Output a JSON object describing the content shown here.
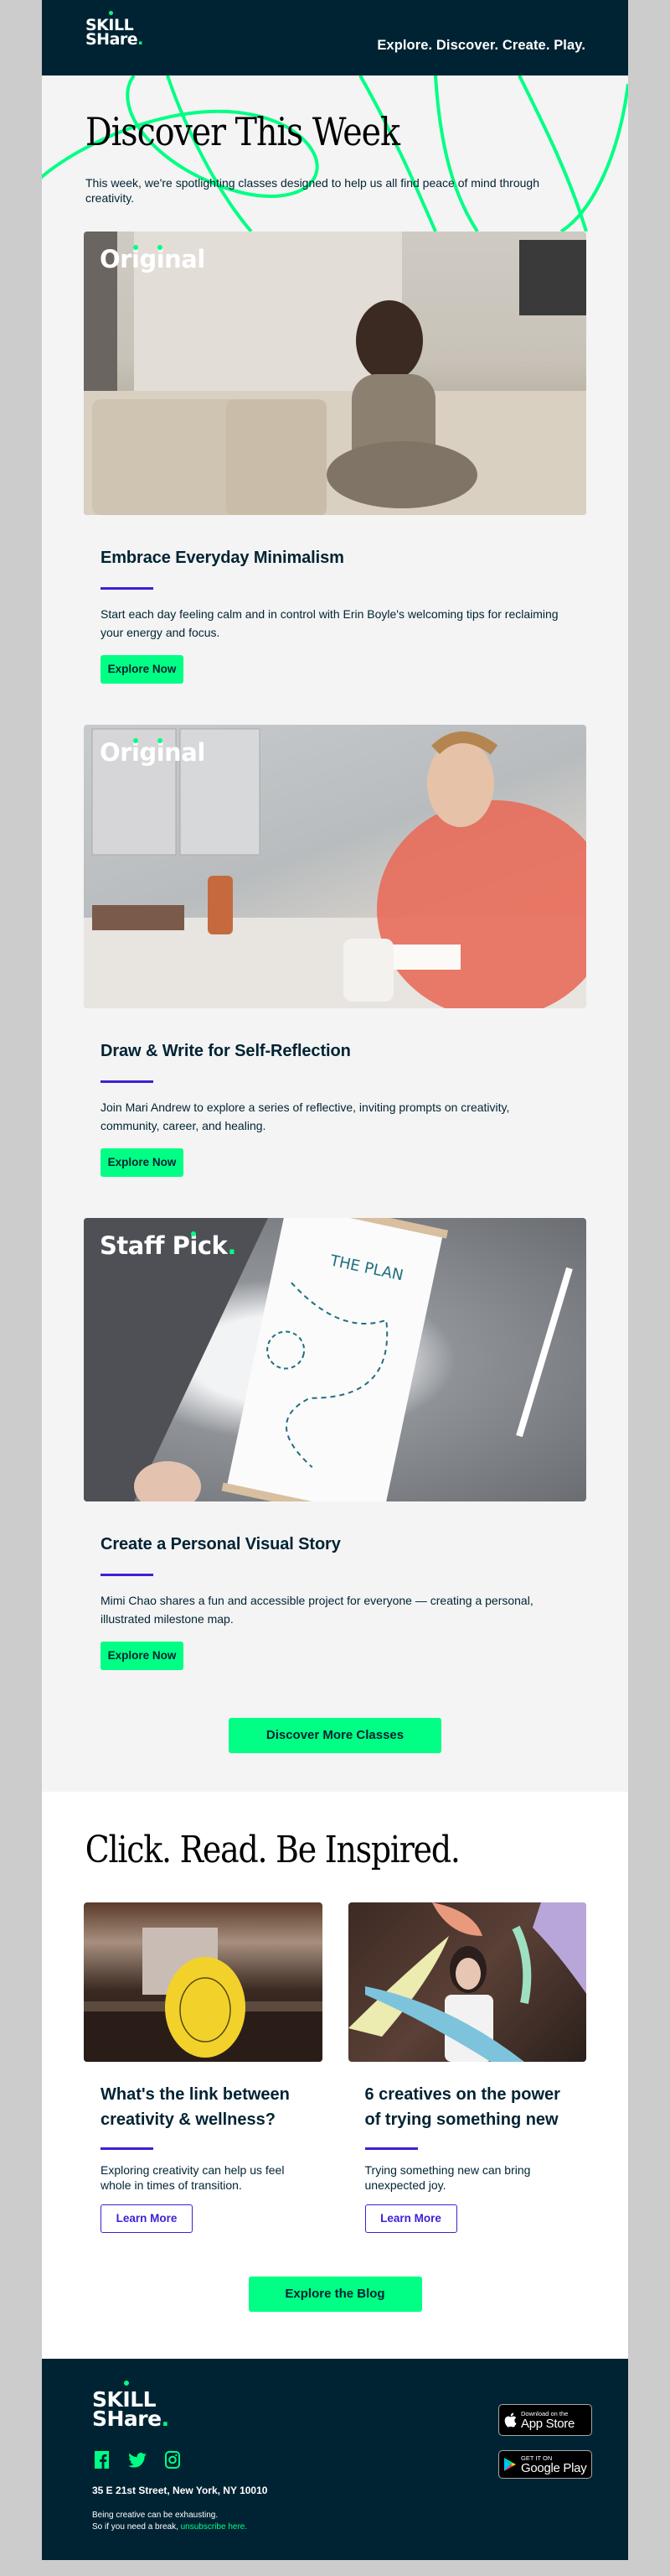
{
  "brand": {
    "logo_line1": "SKILL",
    "logo_line2": "SHare",
    "logo_dot": ".",
    "tagline": "Explore. Discover. Create. Play.",
    "colors": {
      "navy": "#002333",
      "green": "#00ff84",
      "purple": "#3d1fd6",
      "bg": "#f4f4f4"
    }
  },
  "hero": {
    "title": "Discover This Week",
    "intro": "This week, we're spotlighting classes designed to help us all find peace of mind through creativity."
  },
  "classes": [
    {
      "badge": "Original",
      "image_alt": "Woman reading a book on a couch",
      "title": "Embrace Everyday Minimalism",
      "description": "Start each day feeling calm and in control with Erin Boyle's welcoming tips for reclaiming your energy and focus.",
      "cta": "Explore Now"
    },
    {
      "badge": "Original",
      "image_alt": "Woman writing in a notebook at a table",
      "title": "Draw & Write for Self-Reflection",
      "description": "Join Mari Andrew to explore a series of reflective, inviting prompts on creativity, community, career, and healing.",
      "cta": "Explore Now"
    },
    {
      "badge": "Staff Pick",
      "image_alt": "Illustrated milestone map titled The Plan on a rug",
      "title": "Create a Personal Visual Story",
      "description": "Mimi Chao shares a fun and accessible project for everyone — creating a personal, illustrated milestone map.",
      "cta": "Explore Now"
    }
  ],
  "discover_more": "Discover More Classes",
  "blog": {
    "heading": "Click. Read. Be Inspired.",
    "posts": [
      {
        "image_alt": "Have a great day sun sticker",
        "title": "What's the link between creativity & wellness?",
        "description": "Exploring creativity can help us feel whole in times of transition.",
        "cta": "Learn More"
      },
      {
        "image_alt": "Woman surrounded by paint splashes",
        "title": "6 creatives on the power of trying something new",
        "description": "Trying something new can bring unexpected joy.",
        "cta": "Learn More"
      }
    ],
    "cta": "Explore the Blog"
  },
  "footer": {
    "socials": [
      {
        "name": "facebook",
        "icon": "facebook-icon"
      },
      {
        "name": "twitter",
        "icon": "twitter-icon"
      },
      {
        "name": "instagram",
        "icon": "instagram-icon"
      }
    ],
    "address": "35 E 21st Street, New York, NY 10010",
    "fine_line1": "Being creative can be exhausting.",
    "fine_line2": "So if you need a break, ",
    "unsubscribe": "unsubscribe here.",
    "app_store": {
      "small": "Download on the",
      "big": "App Store"
    },
    "google_play": {
      "small": "GET IT ON",
      "big": "Google Play"
    }
  }
}
